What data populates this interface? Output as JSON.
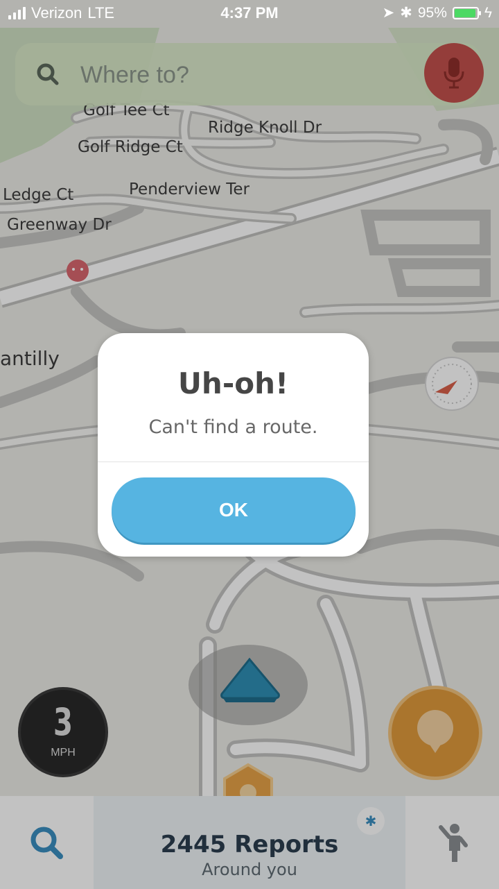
{
  "status_bar": {
    "carrier": "Verizon",
    "network": "LTE",
    "time": "4:37 PM",
    "battery": "95%",
    "battery_level": 0.95
  },
  "search": {
    "placeholder": "Where to?"
  },
  "map": {
    "street_labels": [
      "Golf Tee Ct",
      "Ridge Knoll Dr",
      "Golf Ridge Ct",
      "Penderview Ter",
      "Ledge Ct",
      "Greenway Dr",
      "antilly"
    ]
  },
  "dialog": {
    "title": "Uh-oh!",
    "message": "Can't find a route.",
    "ok_label": "OK"
  },
  "speedometer": {
    "value": "3",
    "unit": "MPH"
  },
  "bottom_bar": {
    "reports_count": "2445 Reports",
    "reports_sub": "Around you"
  },
  "colors": {
    "dialog_button": "#56b4e1",
    "mic_button": "#c3514d",
    "report_button": "#e09a3c",
    "vehicle_arrow": "#2f8fb5"
  }
}
